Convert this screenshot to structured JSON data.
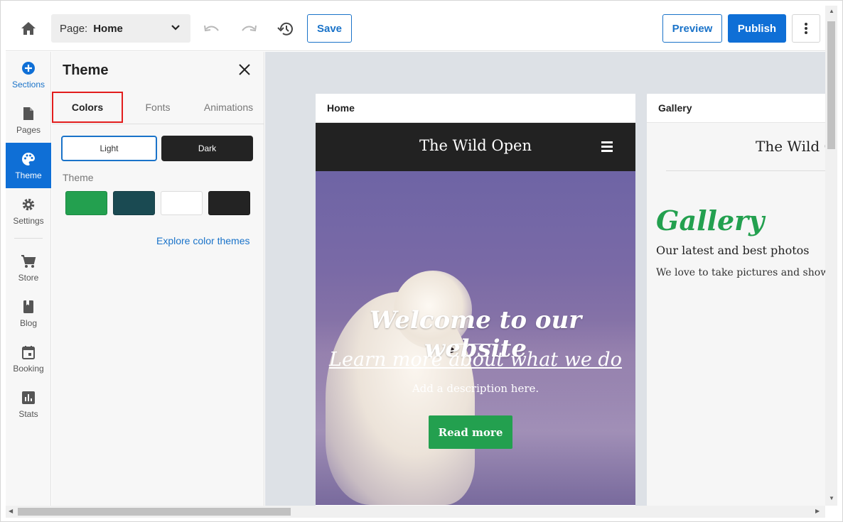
{
  "topbar": {
    "page_label": "Page:",
    "page_value": "Home",
    "save_label": "Save",
    "preview_label": "Preview",
    "publish_label": "Publish"
  },
  "rail": {
    "items": [
      {
        "label": "Sections",
        "icon": "plus-circle-icon"
      },
      {
        "label": "Pages",
        "icon": "page-icon"
      },
      {
        "label": "Theme",
        "icon": "palette-icon",
        "active": true
      },
      {
        "label": "Settings",
        "icon": "gear-icon"
      },
      {
        "label": "Store",
        "icon": "cart-icon"
      },
      {
        "label": "Blog",
        "icon": "book-icon"
      },
      {
        "label": "Booking",
        "icon": "calendar-icon"
      },
      {
        "label": "Stats",
        "icon": "bar-chart-icon"
      }
    ]
  },
  "panel": {
    "title": "Theme",
    "tabs": [
      "Colors",
      "Fonts",
      "Animations"
    ],
    "active_tab": "Colors",
    "mode_light": "Light",
    "mode_dark": "Dark",
    "theme_label": "Theme",
    "swatches": [
      "#23a04f",
      "#1a4a52",
      "#ffffff",
      "#232323"
    ],
    "explore_link": "Explore color themes"
  },
  "canvas": {
    "home": {
      "frame_title": "Home",
      "site_name": "The Wild Open",
      "hero_title": "Welcome to our website",
      "hero_link": "Learn more about what we do",
      "hero_desc": "Add a description here.",
      "hero_button": "Read more"
    },
    "gallery": {
      "frame_title": "Gallery",
      "site_name": "The Wild O",
      "title": "Gallery",
      "subtitle": "Our latest and best photos",
      "description": "We love to take pictures and show"
    }
  },
  "colors": {
    "accent": "#0f6fd6",
    "green": "#23a04f",
    "highlight": "#e21d1d"
  }
}
